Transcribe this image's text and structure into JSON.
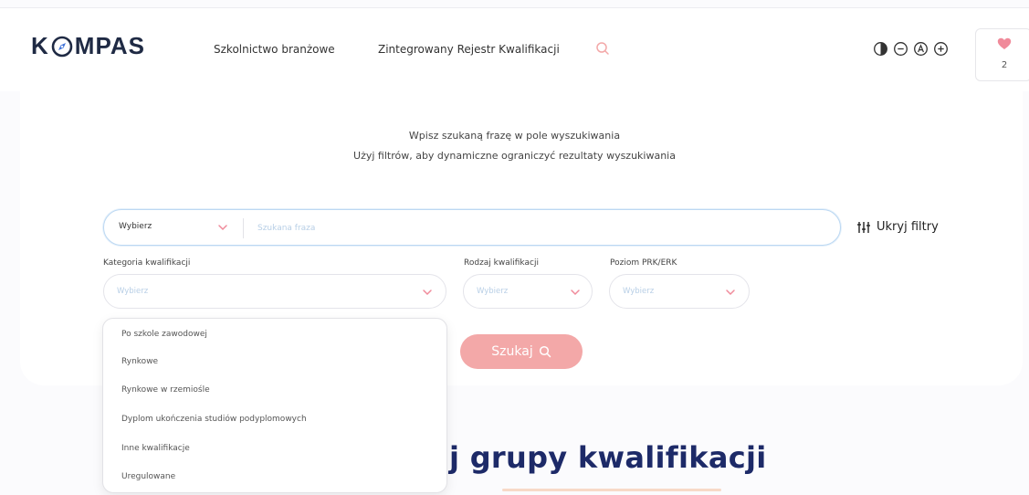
{
  "header": {
    "logo": {
      "left": "K",
      "right": "MPAS"
    },
    "nav": [
      "Szkolnictwo branżowe",
      "Zintegrowany Rejestr Kwalifikacji"
    ],
    "favorites": {
      "count": "2"
    },
    "icons": [
      "contrast-icon",
      "zoom-out-icon",
      "font-size-icon",
      "zoom-in-icon"
    ]
  },
  "intro": {
    "line1": "Wpisz szukaną frazę w pole wyszukiwania",
    "line2": "Użyj filtrów, aby dynamiczne ograniczyć rezultaty wyszukiwania"
  },
  "search": {
    "select_value": "Wybierz",
    "placeholder": "Szukana fraza",
    "toggle_label": "Ukryj filtry",
    "button_label": "Szukaj"
  },
  "filters": [
    {
      "label": "Kategoria kwalifikacji",
      "placeholder": "Wybierz"
    },
    {
      "label": "Rodzaj kwalifikacji",
      "placeholder": "Wybierz"
    },
    {
      "label": "Poziom PRK/ERK",
      "placeholder": "Wybierz"
    }
  ],
  "dropdown": {
    "options": [
      "Po szkole zawodowej",
      "Rynkowe",
      "Rynkowe w rzemiośle",
      "Dyplom ukończenia studiów podyplomowych",
      "Inne kwalifikacje",
      "Uregulowane"
    ]
  },
  "section": {
    "title": "j grupy kwalifikacji"
  },
  "colors": {
    "brand_navy": "#1d2a68",
    "accent_pink": "#f3a8a8",
    "input_border": "#bcd8f2",
    "heart": "#f08a9a"
  }
}
